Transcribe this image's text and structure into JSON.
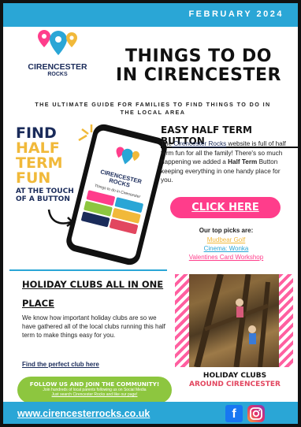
{
  "header": {
    "date": "FEBRUARY 2024"
  },
  "logo": {
    "name": "CIRENCESTER",
    "sub": "ROCKS"
  },
  "title": {
    "line1": "THINGS TO DO",
    "line2": "IN CIRENCESTER"
  },
  "subtitle": "THE ULTIMATE GUIDE FOR FAMILIES TO FIND THINGS TO DO IN THE LOCAL AREA",
  "promo": {
    "line1": "FIND",
    "line2": "HALF",
    "line3": "TERM FUN",
    "small": "AT THE TOUCH OF A BUTTON"
  },
  "phone": {
    "name": "CIRENCESTER",
    "sub": "ROCKS",
    "tagline": "Things to do in Cirencester"
  },
  "easy_button": {
    "heading": "EASY HALF TERM BUTTON",
    "text_pre": "The",
    "link": " Cirencester Rocks",
    "text_mid": " website is full of half term fun for all the family! There's so much happening we added a ",
    "bold": "Half Term",
    "text_post": " Button keeping everything in one handy place for you.",
    "button": "CLICK HERE",
    "picks_label": "Our top picks are:",
    "picks": [
      {
        "label": "Mudbear Golf",
        "color": "#f1b93a"
      },
      {
        "label": "Cinema: Wonka",
        "color": "#2aa6d6"
      },
      {
        "label": "Valentines Card Workshop",
        "color": "#ff3d8b"
      }
    ]
  },
  "holiday": {
    "heading": "HOLIDAY CLUBS ALL IN ONE PLACE",
    "text": "We know how important holiday clubs are so we have gathered all of the local clubs running this half term to make things easy for you.",
    "link": "Find the perfect club here",
    "caption1": "HOLIDAY CLUBS",
    "caption2": "AROUND CIRENCESTER"
  },
  "community": {
    "title": "FOLLOW US AND JOIN THE COMMUNITY!",
    "text": "Join hundreds of local parents following us on Social Media",
    "link": "Just search Cirencester Rocks and like our page!"
  },
  "footer": {
    "url": "www.cirencesterrocks.co.uk",
    "fb": "f"
  },
  "colors": {
    "blue": "#2aa6d6",
    "navy": "#1a2b5a",
    "pink": "#ff3d8b",
    "yellow": "#f1b93a",
    "green": "#8dc63f"
  }
}
